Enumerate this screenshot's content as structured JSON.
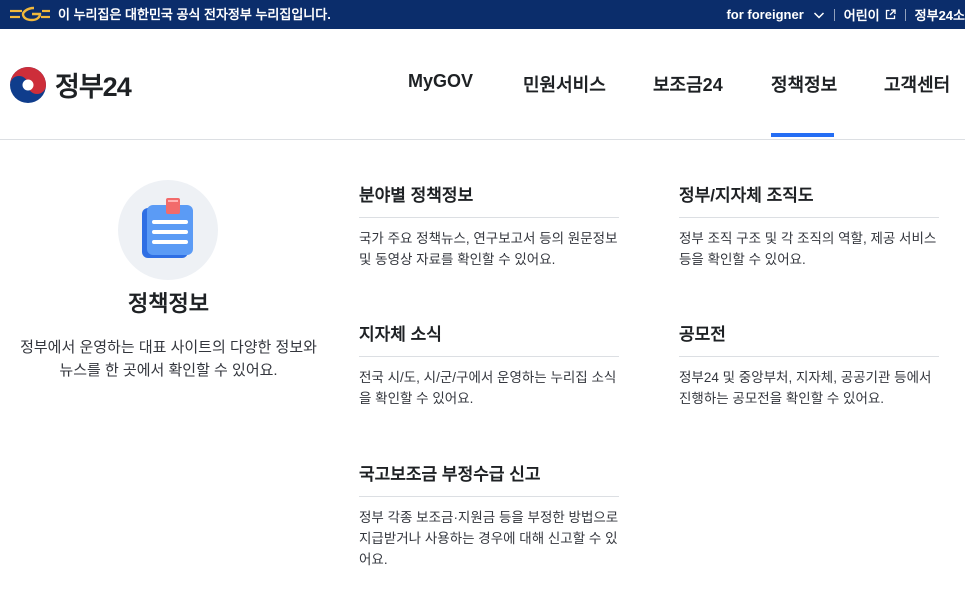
{
  "gov_banner": {
    "notice": "이 누리집은 대한민국 공식 전자정부 누리집입니다.",
    "foreigner_label": "for foreigner",
    "kids_label": "어린이",
    "site_label": "정부24소"
  },
  "header": {
    "brand": "정부24",
    "nav": [
      {
        "label": "MyGOV"
      },
      {
        "label": "민원서비스"
      },
      {
        "label": "보조금24"
      },
      {
        "label": "정책정보"
      },
      {
        "label": "고객센터"
      }
    ]
  },
  "panel": {
    "title": "정책정보",
    "description": "정부에서 운영하는 대표 사이트의 다양한 정보와 뉴스를 한 곳에서 확인할 수 있어요.",
    "items": [
      {
        "title": "분야별 정책정보",
        "desc": "국가 주요 정책뉴스, 연구보고서 등의 원문정보 및 동영상 자료를 확인할 수 있어요."
      },
      {
        "title": "지자체 소식",
        "desc": "전국 시/도, 시/군/구에서 운영하는 누리집 소식을 확인할 수 있어요."
      },
      {
        "title": "국고보조금 부정수급 신고",
        "desc": "정부 각종 보조금·지원금 등을 부정한 방법으로 지급받거나 사용하는 경우에 대해 신고할 수 있어요."
      },
      {
        "title": "정부/지자체 조직도",
        "desc": "정부 조직 구조 및 각 조직의 역할, 제공 서비스 등을 확인할 수 있어요."
      },
      {
        "title": "공모전",
        "desc": "정부24 및 중앙부처, 지자체, 공공기관 등에서 진행하는 공모전을 확인할 수 있어요."
      }
    ]
  },
  "colors": {
    "banner_bg": "#0b2d6b",
    "accent": "#256ef4",
    "emblem_red": "#cd2e3a",
    "emblem_blue": "#0f3d8c"
  },
  "icons": [
    "eg-logo-icon",
    "chevron-down-icon",
    "external-link-icon",
    "taegeuk-emblem-icon",
    "notepad-icon"
  ]
}
